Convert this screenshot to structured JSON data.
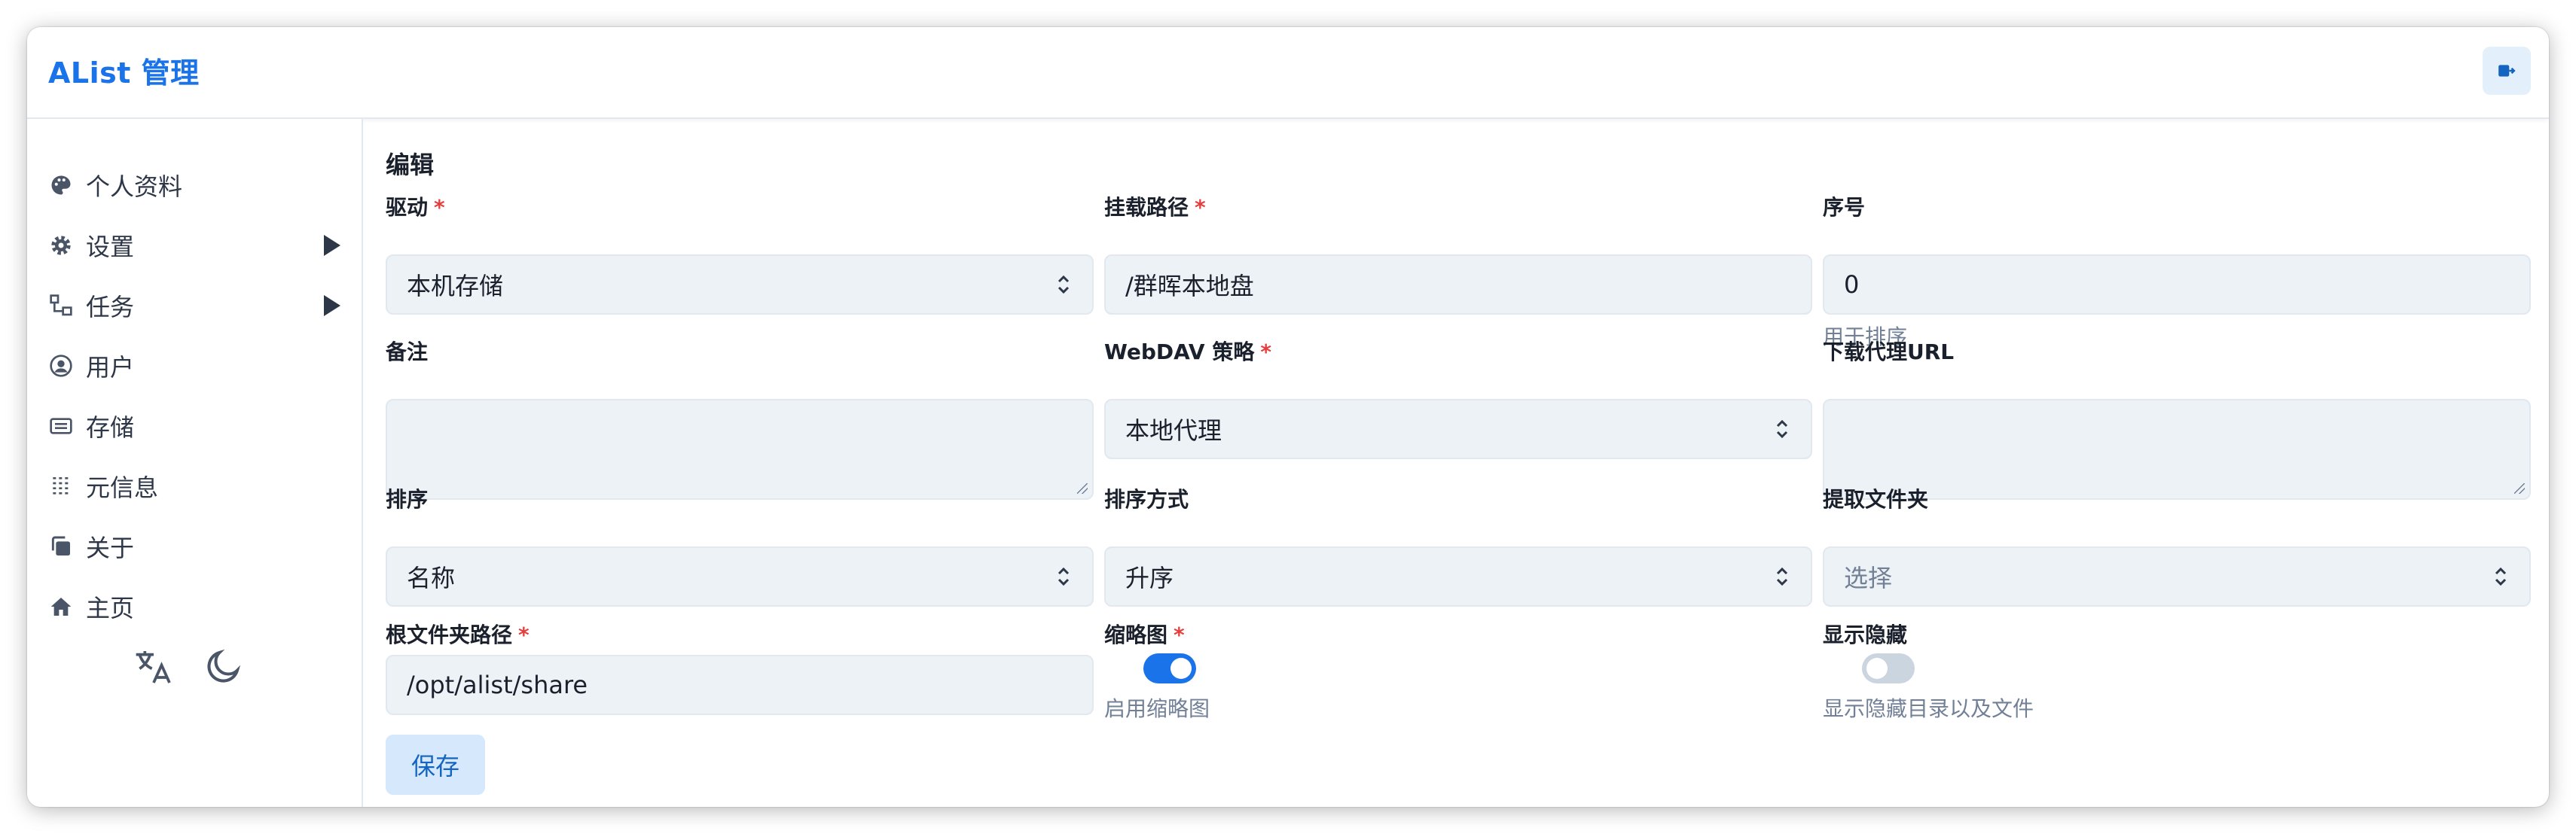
{
  "app": {
    "title": "AList 管理"
  },
  "sidebar": {
    "items": [
      {
        "label": "个人资料",
        "icon": "palette-icon"
      },
      {
        "label": "设置",
        "icon": "gear-icon",
        "expandable": true
      },
      {
        "label": "任务",
        "icon": "tasks-icon",
        "expandable": true
      },
      {
        "label": "用户",
        "icon": "user-circle-icon"
      },
      {
        "label": "存储",
        "icon": "storage-icon"
      },
      {
        "label": "元信息",
        "icon": "meta-icon"
      },
      {
        "label": "关于",
        "icon": "copy-icon"
      },
      {
        "label": "主页",
        "icon": "home-icon"
      }
    ]
  },
  "form": {
    "title": "编辑",
    "driver": {
      "label": "驱动",
      "value": "本机存储",
      "required": true
    },
    "mount_path": {
      "label": "挂载路径",
      "value": "/群晖本地盘",
      "required": true
    },
    "order": {
      "label": "序号",
      "value": "0",
      "helper": "用于排序"
    },
    "remark": {
      "label": "备注",
      "value": ""
    },
    "webdav_policy": {
      "label": "WebDAV 策略",
      "value": "本地代理",
      "required": true
    },
    "download_proxy_url": {
      "label": "下载代理URL",
      "value": ""
    },
    "sort": {
      "label": "排序",
      "value": "名称"
    },
    "sort_direction": {
      "label": "排序方式",
      "value": "升序"
    },
    "extract_folder": {
      "label": "提取文件夹",
      "placeholder": "选择"
    },
    "root_folder_path": {
      "label": "根文件夹路径",
      "value": "/opt/alist/share",
      "required": true
    },
    "thumbnail": {
      "label": "缩略图",
      "helper": "启用缩略图",
      "enabled": true,
      "required": true
    },
    "show_hidden": {
      "label": "显示隐藏",
      "helper": "显示隐藏目录以及文件",
      "enabled": false
    },
    "save_label": "保存"
  },
  "required_mark": "*",
  "colors": {
    "accent": "#1a73e8",
    "required": "#e53e3e",
    "field_bg": "#edf2f7"
  }
}
